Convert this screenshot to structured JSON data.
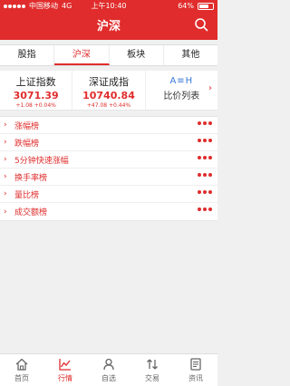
{
  "status_bar": {
    "carrier": "中国移动",
    "network": "4G",
    "time": "上午10:40",
    "battery": "64%"
  },
  "header": {
    "title": "沪深",
    "search_icon": "search-icon"
  },
  "tabs": [
    {
      "label": "股指",
      "active": false
    },
    {
      "label": "沪深",
      "active": true
    },
    {
      "label": "板块",
      "active": false
    },
    {
      "label": "其他",
      "active": false
    }
  ],
  "indices": [
    {
      "name": "上证指数",
      "value": "3071.39",
      "change": "+1.08",
      "change_pct": "+0.04%"
    },
    {
      "name": "深证成指",
      "value": "10740.84",
      "change": "+47.08",
      "change_pct": "+0.44%"
    }
  ],
  "compare": {
    "icon_text": "A≡H",
    "label": "比价列表",
    "arrow": "›"
  },
  "rank_list": [
    {
      "label": "涨幅榜"
    },
    {
      "label": "跌幅榜"
    },
    {
      "label": "5分钟快速涨幅"
    },
    {
      "label": "换手率榜"
    },
    {
      "label": "量比榜"
    },
    {
      "label": "成交额榜"
    }
  ],
  "bottom_tabs": [
    {
      "label": "首页",
      "icon": "home-icon",
      "active": false
    },
    {
      "label": "行情",
      "icon": "chart-icon",
      "active": true
    },
    {
      "label": "自选",
      "icon": "user-icon",
      "active": false
    },
    {
      "label": "交易",
      "icon": "trade-icon",
      "active": false
    },
    {
      "label": "资讯",
      "icon": "news-icon",
      "active": false
    }
  ],
  "colors": {
    "accent": "#e02c2c",
    "link_blue": "#3a78d6"
  }
}
